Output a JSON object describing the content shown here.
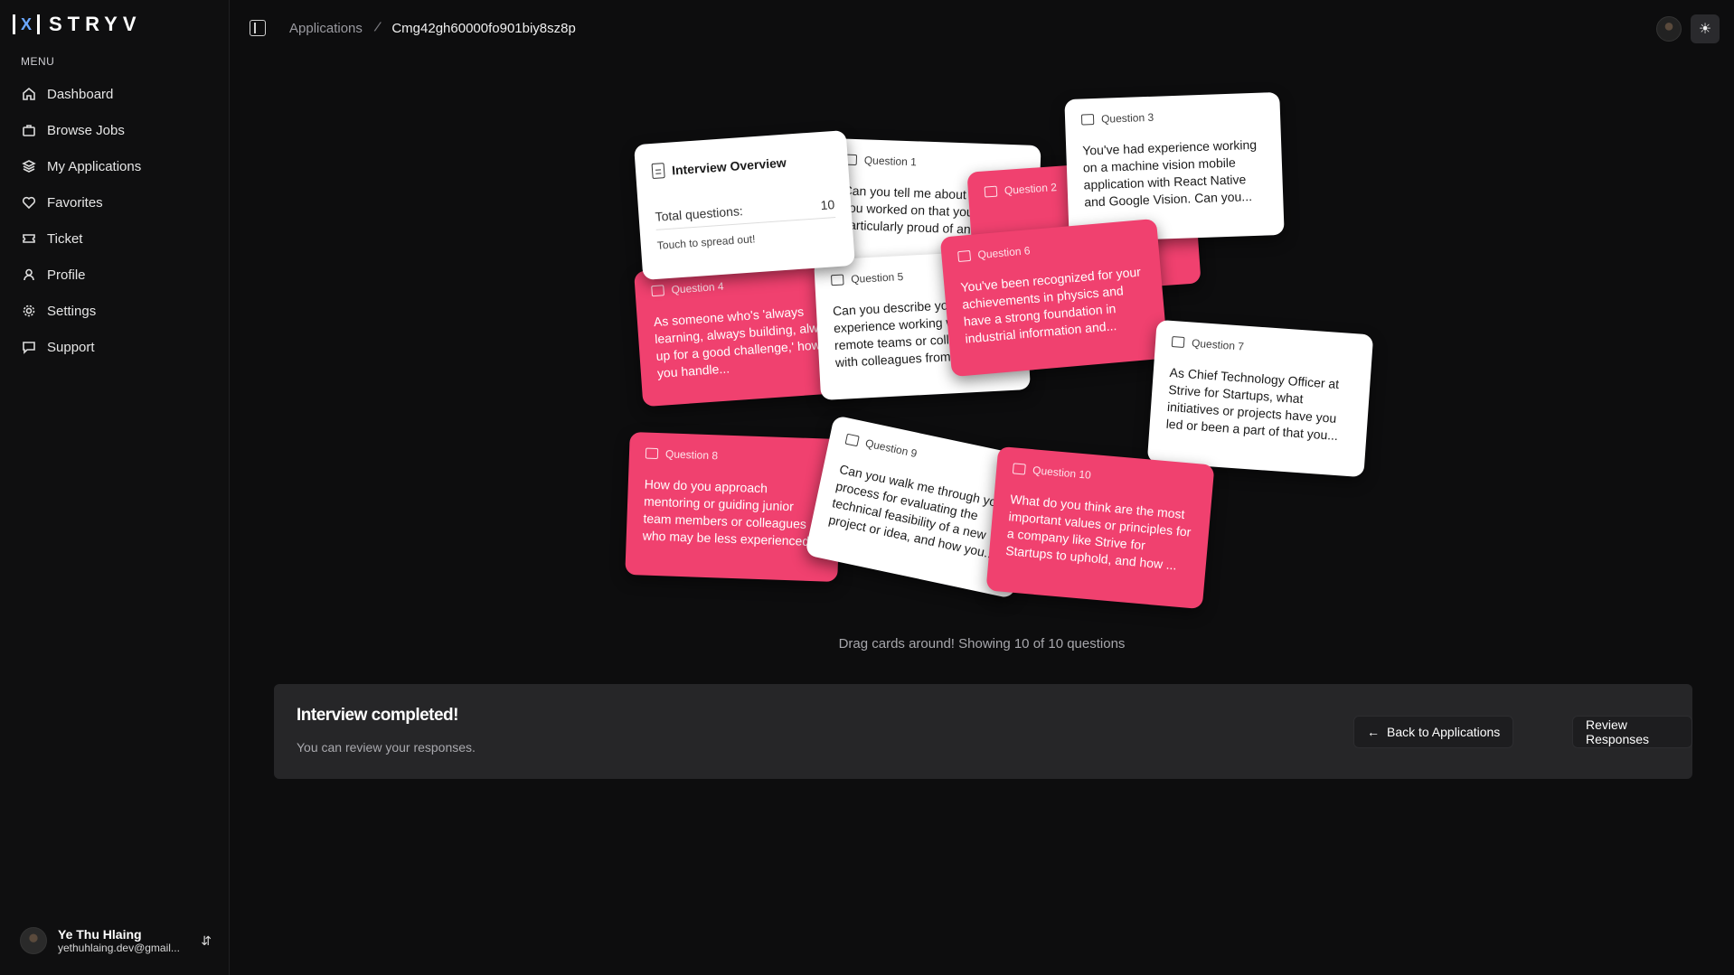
{
  "app": {
    "brand": "STRYV",
    "logo_mark": "X"
  },
  "sidebar": {
    "menu_label": "MENU",
    "items": [
      {
        "label": "Dashboard",
        "icon": "home-icon"
      },
      {
        "label": "Browse Jobs",
        "icon": "briefcase-icon"
      },
      {
        "label": "My Applications",
        "icon": "layers-icon"
      },
      {
        "label": "Favorites",
        "icon": "heart-icon"
      },
      {
        "label": "Ticket",
        "icon": "ticket-icon"
      },
      {
        "label": "Profile",
        "icon": "user-icon"
      },
      {
        "label": "Settings",
        "icon": "gear-icon"
      },
      {
        "label": "Support",
        "icon": "message-icon"
      }
    ],
    "user": {
      "name": "Ye Thu Hlaing",
      "email": "yethuhlaing.dev@gmail..."
    }
  },
  "header": {
    "breadcrumb": {
      "parent": "Applications",
      "current": "Cmg42gh60000fo901biy8sz8p"
    }
  },
  "overview": {
    "title": "Interview Overview",
    "total_label": "Total questions:",
    "total_value": "10",
    "hint": "Touch to spread out!"
  },
  "cards": [
    {
      "label": "Question 1",
      "text": "Can you tell me about a project you worked on that you're particularly proud of and why?",
      "color": "white"
    },
    {
      "label": "Question 2",
      "text": "",
      "color": "pink"
    },
    {
      "label": "Question 3",
      "text": "You've had experience working on a machine vision mobile application with React Native and Google Vision. Can you...",
      "color": "white"
    },
    {
      "label": "Question 4",
      "text": "As someone who's 'always learning, always building, always up for a good challenge,' how do you handle...",
      "color": "pink"
    },
    {
      "label": "Question 5",
      "text": "Can you describe your experience working with remote teams or collaborating with colleagues from...",
      "color": "white"
    },
    {
      "label": "Question 6",
      "text": "You've been recognized for your achievements in physics and have a strong foundation in industrial information and...",
      "color": "pink"
    },
    {
      "label": "Question 7",
      "text": "As Chief Technology Officer at Strive for Startups, what initiatives or projects have you led or been a part of that you...",
      "color": "white"
    },
    {
      "label": "Question 8",
      "text": "How do you approach mentoring or guiding junior team members or colleagues who may be less experienced...",
      "color": "pink"
    },
    {
      "label": "Question 9",
      "text": "Can you walk me through your process for evaluating the technical feasibility of a new project or idea, and how you...",
      "color": "white"
    },
    {
      "label": "Question 10",
      "text": "What do you think are the most important values or principles for a company like Strive for Startups to uphold, and how ...",
      "color": "pink"
    }
  ],
  "drag_hint": "Drag cards around! Showing 10 of 10 questions",
  "panel": {
    "title": "Interview completed!",
    "subtitle": "You can review your responses.",
    "back_label": "Back to Applications",
    "review_label": "Review Responses"
  },
  "colors": {
    "accent_pink": "#f0416f",
    "background": "#0d0d0e",
    "panel": "#262628"
  }
}
